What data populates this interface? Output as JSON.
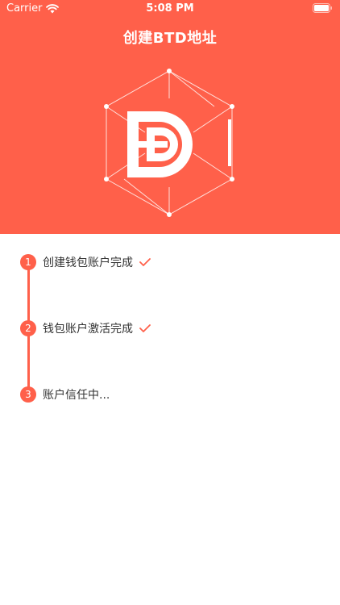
{
  "status_bar": {
    "carrier": "Carrier",
    "time": "5:08 PM"
  },
  "header": {
    "title": "创建BTD地址"
  },
  "steps": [
    {
      "number": "1",
      "label": "创建钱包账户完成",
      "done": true
    },
    {
      "number": "2",
      "label": "钱包账户激活完成",
      "done": true
    },
    {
      "number": "3",
      "label": "账户信任中...",
      "done": false
    }
  ],
  "colors": {
    "accent": "#ff604a",
    "text": "#333333"
  }
}
